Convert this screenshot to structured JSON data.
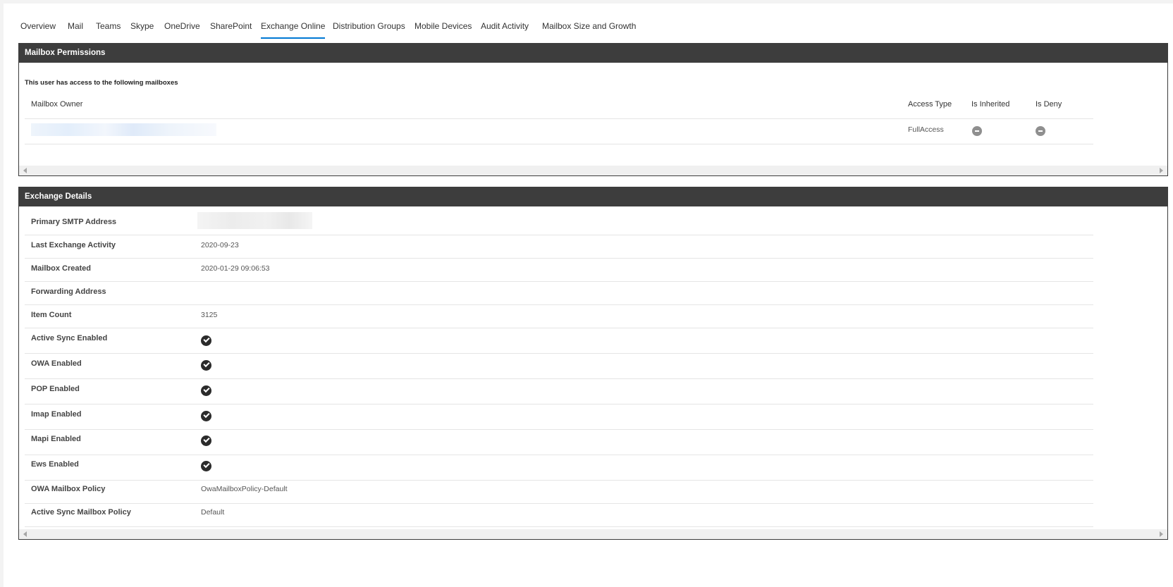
{
  "tabs": [
    {
      "label": "Overview"
    },
    {
      "label": "Mail"
    },
    {
      "label": "Teams"
    },
    {
      "label": "Skype"
    },
    {
      "label": "OneDrive"
    },
    {
      "label": "SharePoint"
    },
    {
      "label": "Exchange Online",
      "active": true
    },
    {
      "label": "Distribution Groups"
    },
    {
      "label": "Mobile Devices"
    },
    {
      "label": "Audit Activity"
    },
    {
      "label": "Mailbox Size and Growth"
    }
  ],
  "accent_color": "#0078d4",
  "mailbox_permissions": {
    "title": "Mailbox Permissions",
    "intro": "This user has access to the following mailboxes",
    "columns": {
      "owner": "Mailbox Owner",
      "access_type": "Access Type",
      "is_inherited": "Is Inherited",
      "is_deny": "Is Deny"
    },
    "rows": [
      {
        "owner": "",
        "access_type": "FullAccess",
        "is_inherited_icon": "minus-circle-icon",
        "is_deny_icon": "minus-circle-icon"
      }
    ]
  },
  "exchange_details": {
    "title": "Exchange Details",
    "rows": [
      {
        "label": "Primary SMTP Address",
        "value": ""
      },
      {
        "label": "Last Exchange Activity",
        "value": "2020-09-23"
      },
      {
        "label": "Mailbox Created",
        "value": "2020-01-29 09:06:53"
      },
      {
        "label": "Forwarding Address",
        "value": ""
      },
      {
        "label": "Item Count",
        "value": "3125"
      },
      {
        "label": "Active Sync Enabled",
        "icon": "check-circle-icon"
      },
      {
        "label": "OWA Enabled",
        "icon": "check-circle-icon"
      },
      {
        "label": "POP Enabled",
        "icon": "check-circle-icon"
      },
      {
        "label": "Imap Enabled",
        "icon": "check-circle-icon"
      },
      {
        "label": "Mapi Enabled",
        "icon": "check-circle-icon"
      },
      {
        "label": "Ews Enabled",
        "icon": "check-circle-icon"
      },
      {
        "label": "OWA Mailbox Policy",
        "value": "OwaMailboxPolicy-Default"
      },
      {
        "label": "Active Sync Mailbox Policy",
        "value": "Default"
      }
    ]
  }
}
